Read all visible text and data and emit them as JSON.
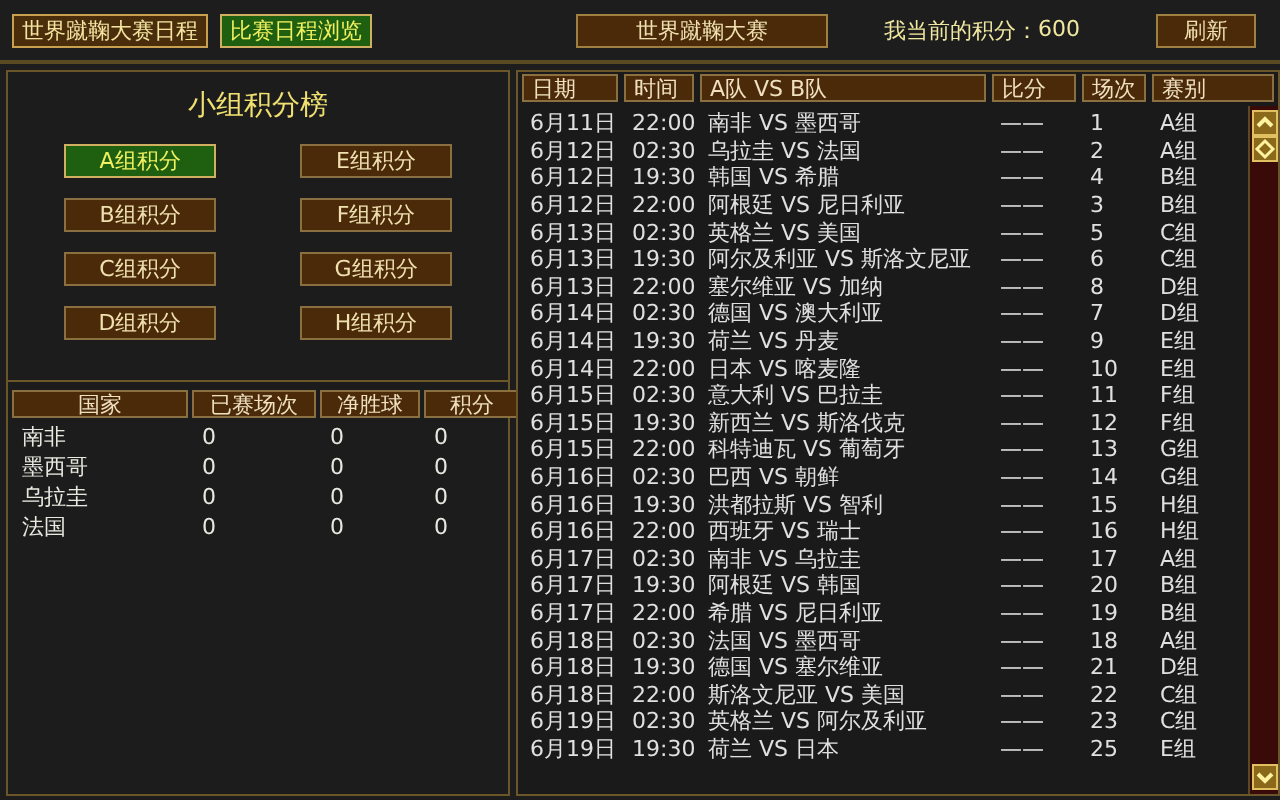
{
  "top_tabs": [
    {
      "label": "世界蹴鞠大赛日程",
      "selected": false
    },
    {
      "label": "比赛日程浏览",
      "selected": true
    }
  ],
  "center_button": "世界蹴鞠大赛",
  "points": {
    "label": "我当前的积分：",
    "value": "600"
  },
  "refresh_button": "刷新",
  "standings": {
    "title": "小组积分榜",
    "groups": [
      {
        "label": "A组积分",
        "selected": true
      },
      {
        "label": "E组积分",
        "selected": false
      },
      {
        "label": "B组积分",
        "selected": false
      },
      {
        "label": "F组积分",
        "selected": false
      },
      {
        "label": "C组积分",
        "selected": false
      },
      {
        "label": "G组积分",
        "selected": false
      },
      {
        "label": "D组积分",
        "selected": false
      },
      {
        "label": "H组积分",
        "selected": false
      }
    ],
    "columns": [
      "国家",
      "已赛场次",
      "净胜球",
      "积分"
    ],
    "rows": [
      [
        "南非",
        "0",
        "0",
        "0"
      ],
      [
        "墨西哥",
        "0",
        "0",
        "0"
      ],
      [
        "乌拉圭",
        "0",
        "0",
        "0"
      ],
      [
        "法国",
        "0",
        "0",
        "0"
      ]
    ]
  },
  "schedule": {
    "columns": [
      "日期",
      "时间",
      "A队 VS B队",
      "比分",
      "场次",
      "赛别"
    ],
    "rows": [
      [
        "6月11日",
        "22:00",
        "南非 VS 墨西哥",
        "——",
        "1",
        "A组"
      ],
      [
        "6月12日",
        "02:30",
        "乌拉圭 VS 法国",
        "——",
        "2",
        "A组"
      ],
      [
        "6月12日",
        "19:30",
        "韩国 VS 希腊",
        "——",
        "4",
        "B组"
      ],
      [
        "6月12日",
        "22:00",
        "阿根廷 VS 尼日利亚",
        "——",
        "3",
        "B组"
      ],
      [
        "6月13日",
        "02:30",
        "英格兰 VS 美国",
        "——",
        "5",
        "C组"
      ],
      [
        "6月13日",
        "19:30",
        "阿尔及利亚 VS 斯洛文尼亚",
        "——",
        "6",
        "C组"
      ],
      [
        "6月13日",
        "22:00",
        "塞尔维亚 VS 加纳",
        "——",
        "8",
        "D组"
      ],
      [
        "6月14日",
        "02:30",
        "德国 VS 澳大利亚",
        "——",
        "7",
        "D组"
      ],
      [
        "6月14日",
        "19:30",
        "荷兰 VS 丹麦",
        "——",
        "9",
        "E组"
      ],
      [
        "6月14日",
        "22:00",
        "日本 VS 喀麦隆",
        "——",
        "10",
        "E组"
      ],
      [
        "6月15日",
        "02:30",
        "意大利 VS 巴拉圭",
        "——",
        "11",
        "F组"
      ],
      [
        "6月15日",
        "19:30",
        "新西兰 VS 斯洛伐克",
        "——",
        "12",
        "F组"
      ],
      [
        "6月15日",
        "22:00",
        "科特迪瓦 VS 葡萄牙",
        "——",
        "13",
        "G组"
      ],
      [
        "6月16日",
        "02:30",
        "巴西 VS 朝鲜",
        "——",
        "14",
        "G组"
      ],
      [
        "6月16日",
        "19:30",
        "洪都拉斯 VS 智利",
        "——",
        "15",
        "H组"
      ],
      [
        "6月16日",
        "22:00",
        "西班牙 VS 瑞士",
        "——",
        "16",
        "H组"
      ],
      [
        "6月17日",
        "02:30",
        "南非 VS 乌拉圭",
        "——",
        "17",
        "A组"
      ],
      [
        "6月17日",
        "19:30",
        "阿根廷 VS 韩国",
        "——",
        "20",
        "B组"
      ],
      [
        "6月17日",
        "22:00",
        "希腊 VS 尼日利亚",
        "——",
        "19",
        "B组"
      ],
      [
        "6月18日",
        "02:30",
        "法国 VS 墨西哥",
        "——",
        "18",
        "A组"
      ],
      [
        "6月18日",
        "19:30",
        "德国 VS 塞尔维亚",
        "——",
        "21",
        "D组"
      ],
      [
        "6月18日",
        "22:00",
        "斯洛文尼亚 VS 美国",
        "——",
        "22",
        "C组"
      ],
      [
        "6月19日",
        "02:30",
        "英格兰 VS 阿尔及利亚",
        "——",
        "23",
        "C组"
      ],
      [
        "6月19日",
        "19:30",
        "荷兰 VS 日本",
        "——",
        "25",
        "E组"
      ]
    ]
  }
}
